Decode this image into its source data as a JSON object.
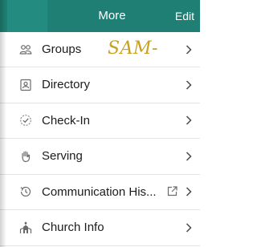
{
  "header": {
    "title": "More",
    "edit_label": "Edit",
    "color": "#1f7f74"
  },
  "annotation": "SAM-",
  "items": [
    {
      "label": "Groups",
      "icon": "groups-icon"
    },
    {
      "label": "Directory",
      "icon": "directory-icon"
    },
    {
      "label": "Check-In",
      "icon": "check-in-icon"
    },
    {
      "label": "Serving",
      "icon": "serving-hand-icon"
    },
    {
      "label": "Communication His...",
      "icon": "history-icon",
      "external_icon": "external-link-icon"
    },
    {
      "label": "Church Info",
      "icon": "church-icon"
    }
  ]
}
